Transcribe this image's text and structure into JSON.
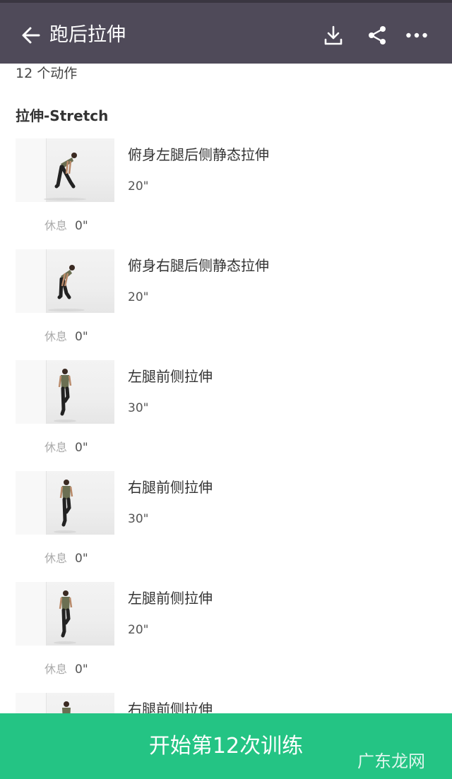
{
  "header": {
    "title": "跑后拉伸",
    "back_icon": "arrow-left-icon",
    "download_icon": "download-icon",
    "share_icon": "share-icon",
    "more_icon": "more-horizontal-icon",
    "bg_color": "#4f4a59"
  },
  "workout": {
    "count_text": "12 个动作",
    "section_title": "拉伸-Stretch",
    "rest_label": "休息",
    "exercises": [
      {
        "name": "俯身左腿后侧静态拉伸",
        "duration": "20\"",
        "rest": "0\""
      },
      {
        "name": "俯身右腿后侧静态拉伸",
        "duration": "20\"",
        "rest": "0\""
      },
      {
        "name": "左腿前侧拉伸",
        "duration": "30\"",
        "rest": "0\""
      },
      {
        "name": "右腿前侧拉伸",
        "duration": "30\"",
        "rest": "0\""
      },
      {
        "name": "左腿前侧拉伸",
        "duration": "20\"",
        "rest": "0\""
      },
      {
        "name": "右腿前侧拉伸",
        "duration": "",
        "rest": ""
      }
    ]
  },
  "footer": {
    "start_button": "开始第12次训练",
    "accent_color": "#24c484"
  },
  "watermark": {
    "text": "广东龙网"
  }
}
